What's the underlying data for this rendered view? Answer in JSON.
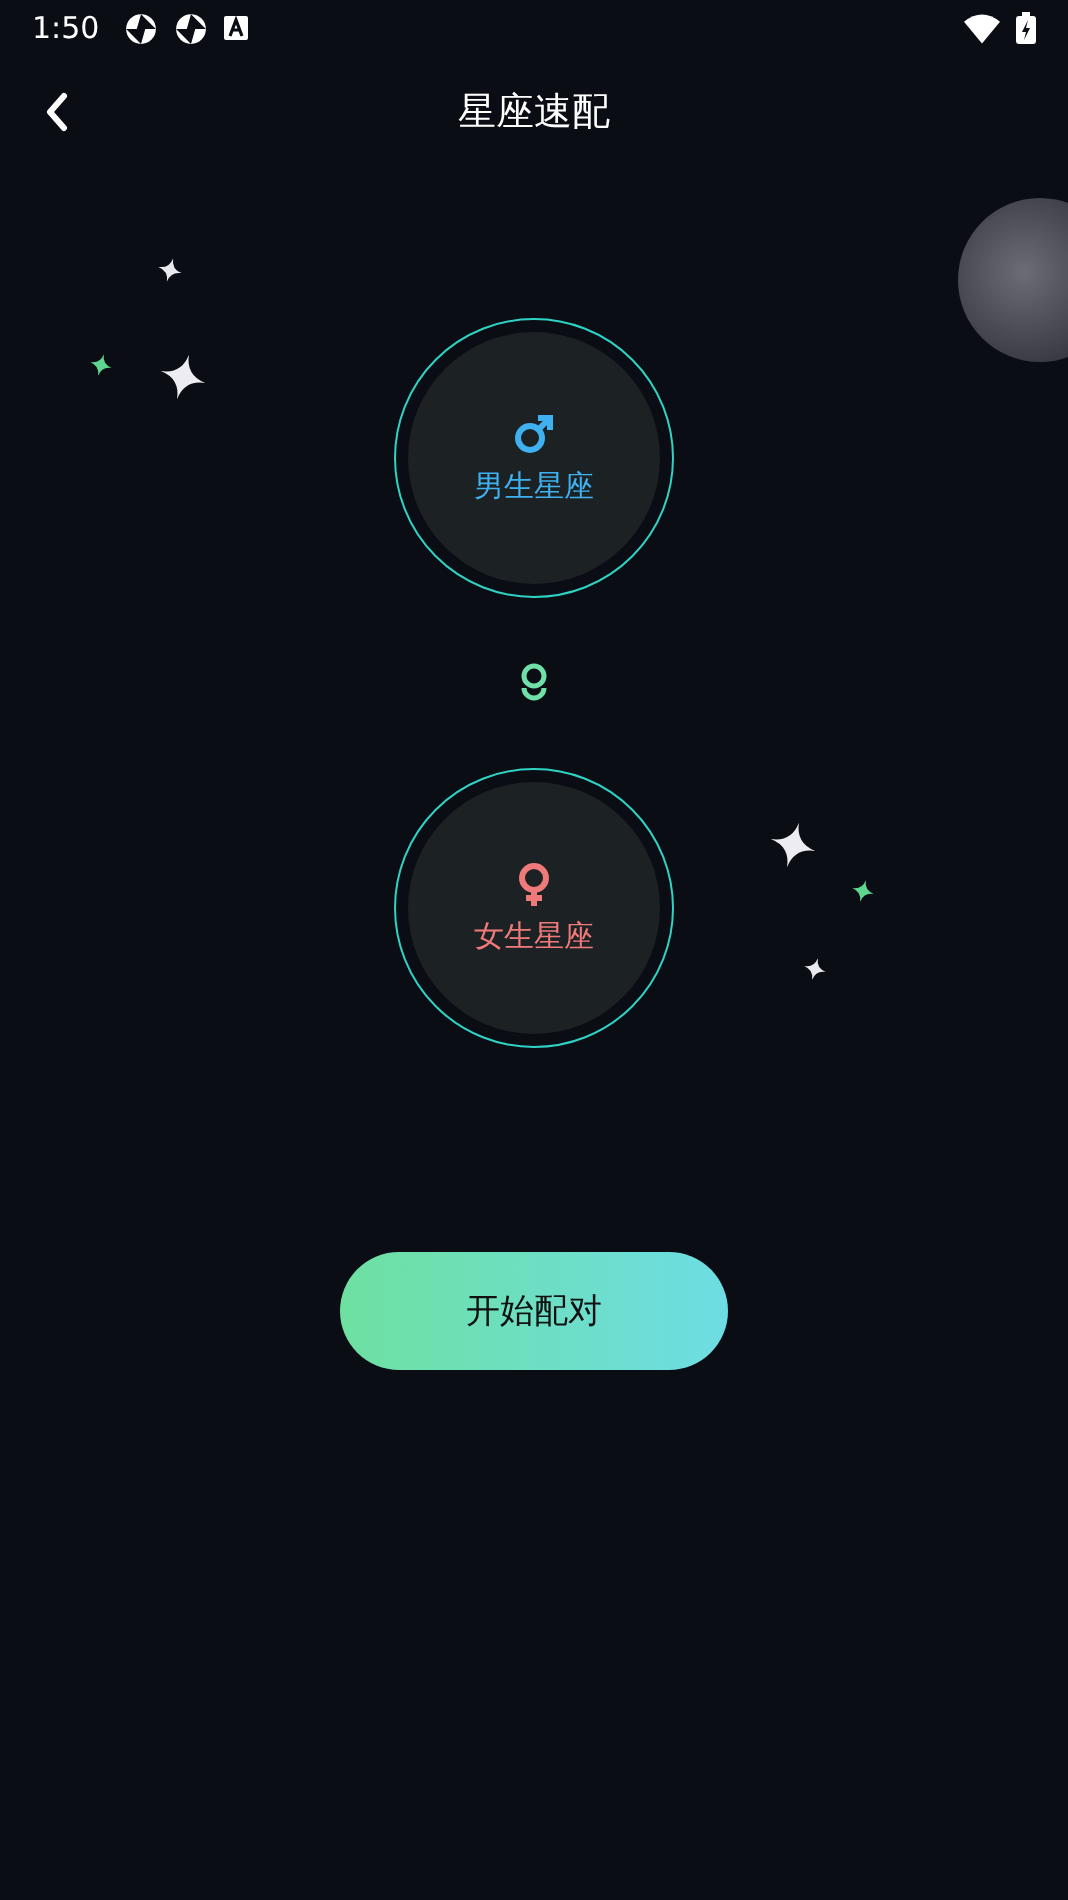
{
  "status_bar": {
    "time": "1:50"
  },
  "header": {
    "title": "星座速配"
  },
  "choices": [
    {
      "kind": "male",
      "label": "男生星座"
    },
    {
      "kind": "female",
      "label": "女生星座"
    }
  ],
  "start_button": {
    "label": "开始配对"
  }
}
